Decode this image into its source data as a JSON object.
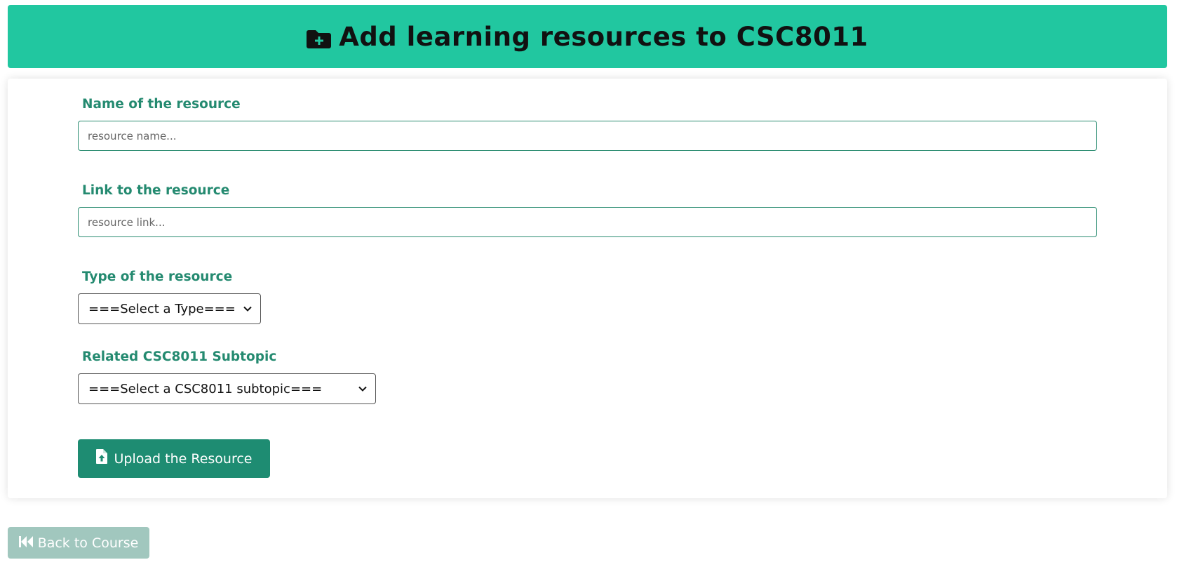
{
  "header": {
    "title": "Add learning resources to CSC8011",
    "icon": "folder-plus-icon",
    "background_color": "#21c7a0"
  },
  "form": {
    "name_field": {
      "label": "Name of the resource",
      "value": "",
      "placeholder": "resource name..."
    },
    "link_field": {
      "label": "Link to the resource",
      "value": "",
      "placeholder": "resource link..."
    },
    "type_select": {
      "label": "Type of the resource",
      "selected": "===Select a Type==="
    },
    "subtopic_select": {
      "label": "Related CSC8011 Subtopic",
      "selected": "===Select a CSC8011 subtopic==="
    },
    "upload_button": {
      "label": "Upload the Resource",
      "icon": "file-upload-icon",
      "color": "#1e8c72"
    }
  },
  "back_button": {
    "label": "Back to Course",
    "icon": "skip-back-icon",
    "color": "#a1c7be"
  },
  "colors": {
    "label_text": "#248a70",
    "input_border": "#2b8c71"
  }
}
